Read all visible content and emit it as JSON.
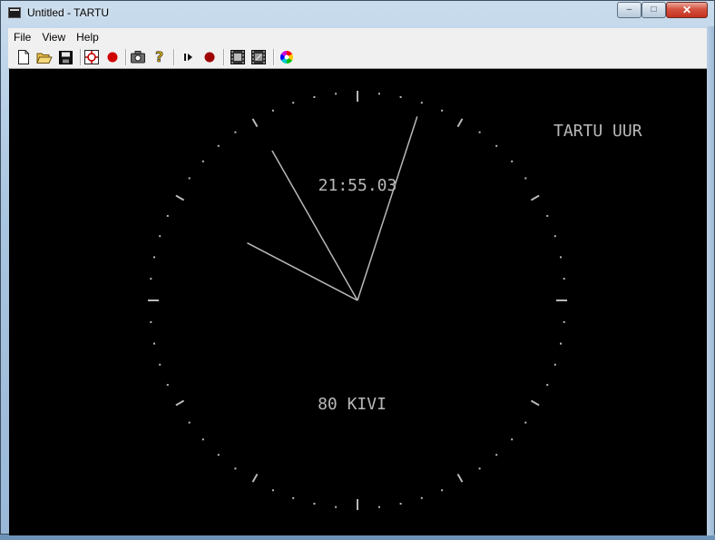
{
  "window": {
    "title": "Untitled - TARTU",
    "controls": {
      "minimize": "–",
      "maximize": "□",
      "close": "✕"
    }
  },
  "menu": [
    "File",
    "View",
    "Help"
  ],
  "toolbar": [
    {
      "name": "new-file-icon"
    },
    {
      "name": "open-folder-icon"
    },
    {
      "name": "save-icon"
    },
    {
      "name": "target-icon"
    },
    {
      "name": "record-icon"
    },
    {
      "name": "camera-icon"
    },
    {
      "name": "help-icon"
    },
    {
      "name": "play-step-icon"
    },
    {
      "name": "stop-record-icon"
    },
    {
      "name": "film-frame-icon"
    },
    {
      "name": "film-frame-alt-icon"
    },
    {
      "name": "color-wheel-icon"
    }
  ],
  "display": {
    "label_top_right": "TARTU UUR",
    "digital_time": "21:55.03",
    "bottom_label": "80 KIVI",
    "time": {
      "hours": 21,
      "minutes": 55,
      "seconds": 3
    },
    "colors": {
      "background": "#000000",
      "foreground": "#b8b8b8"
    }
  }
}
